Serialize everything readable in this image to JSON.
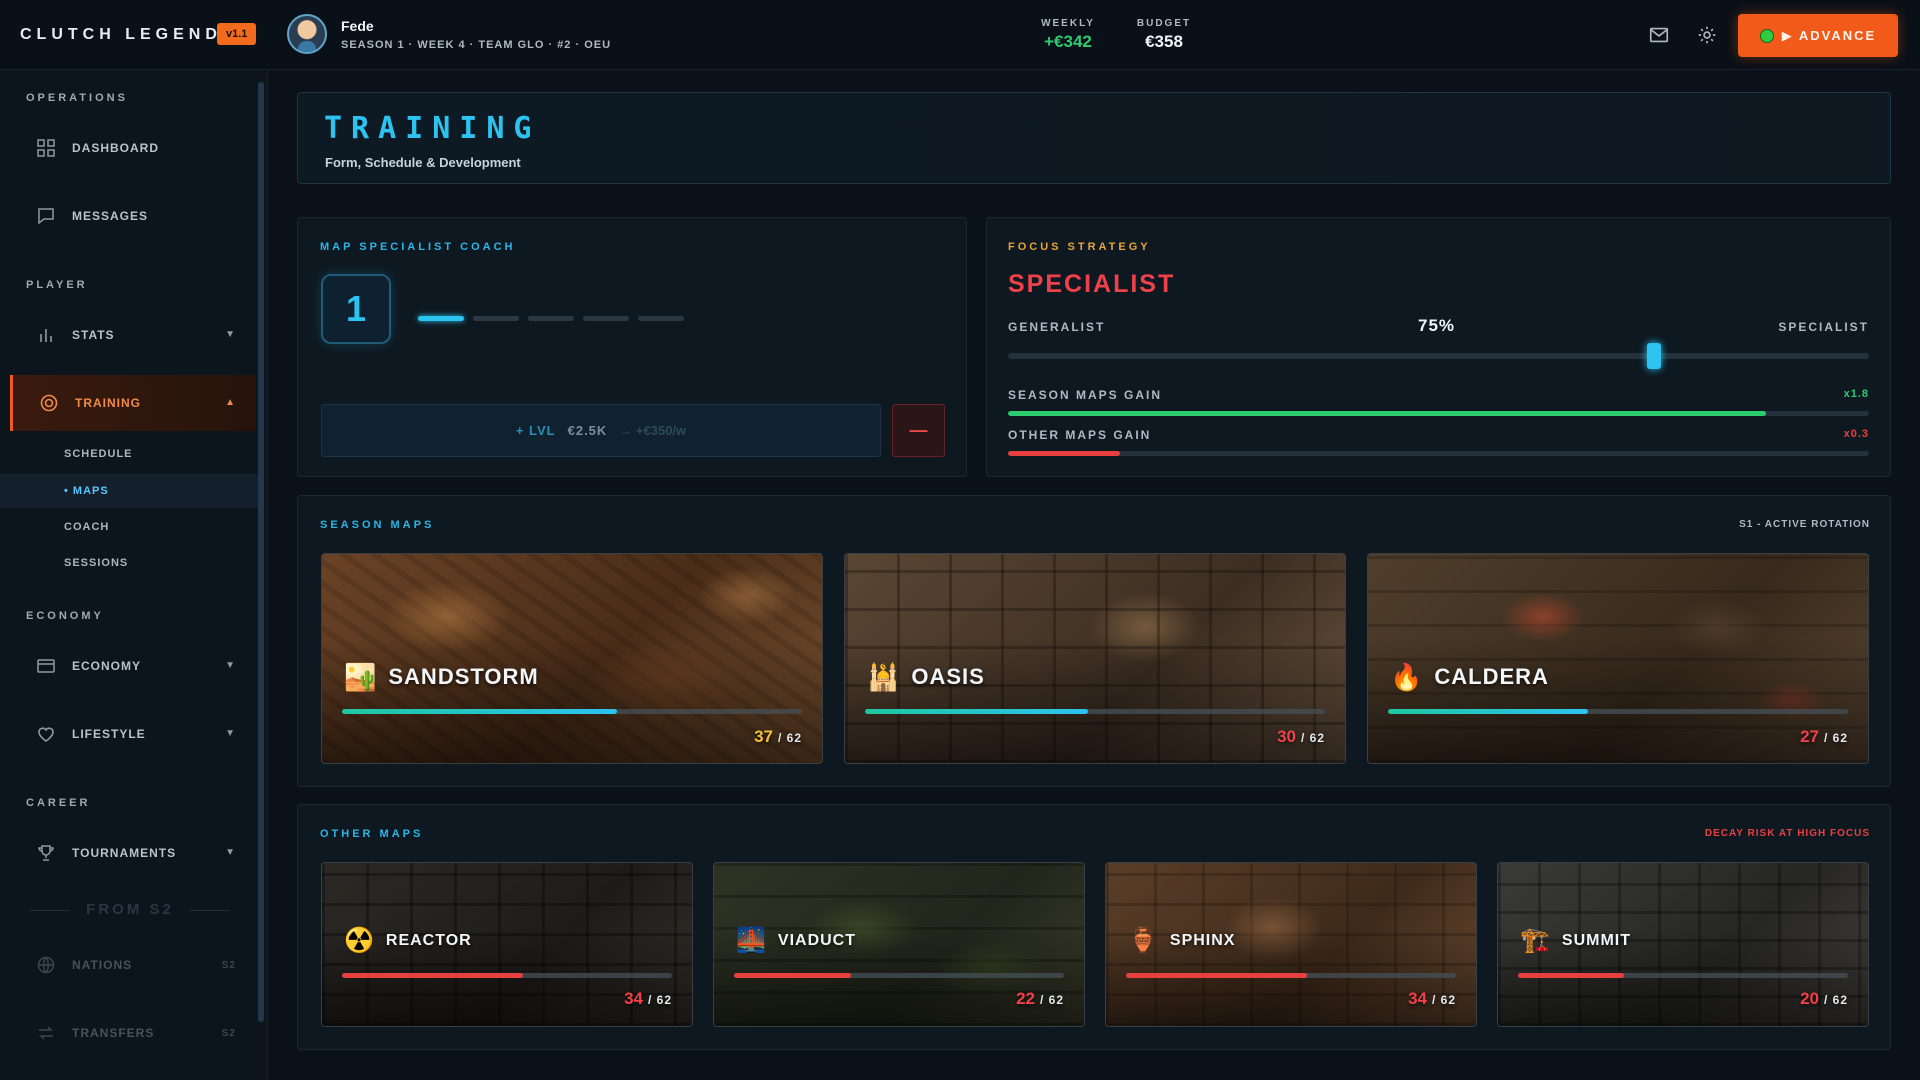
{
  "app": {
    "logo": "CLUTCH LEGEND",
    "version": "v1.1"
  },
  "player": {
    "name": "Fede",
    "meta": "SEASON 1 · WEEK 4 · TEAM GLO · #2 · OEU"
  },
  "stats": {
    "weekly_label": "WEEKLY",
    "weekly_value": "+€342",
    "budget_label": "BUDGET",
    "budget_value": "€358"
  },
  "header_actions": {
    "mail_icon": "mail-icon",
    "settings_icon": "gear-icon",
    "advance_label": "▶ ADVANCE"
  },
  "sidebar": {
    "sections": {
      "operations": "OPERATIONS",
      "player": "PLAYER",
      "economy": "ECONOMY",
      "career": "CAREER"
    },
    "items": {
      "dashboard": "DASHBOARD",
      "messages": "MESSAGES",
      "stats": "STATS",
      "training": "TRAINING",
      "economy": "ECONOMY",
      "lifestyle": "LIFESTYLE",
      "tournaments": "TOURNAMENTS",
      "nations": "NATIONS",
      "transfers": "TRANSFERS"
    },
    "training_sub": {
      "schedule": "SCHEDULE",
      "maps": "• MAPS",
      "coach": "COACH",
      "sessions": "SESSIONS"
    },
    "locked_divider": "FROM S2",
    "locked_tag": "S2"
  },
  "page": {
    "title": "TRAINING",
    "subtitle": "Form, Schedule & Development"
  },
  "coach": {
    "label": "MAP SPECIALIST COACH",
    "level": "1",
    "level_pips_filled": 1,
    "level_pips_total": 5,
    "upgrade_prefix": "+ LVL",
    "upgrade_cost": "€2.5K",
    "upgrade_weekly": "→ +€350/w",
    "downgrade_label": "—"
  },
  "focus": {
    "label": "FOCUS STRATEGY",
    "title": "SPECIALIST",
    "left_label": "GENERALIST",
    "right_label": "SPECIALIST",
    "percent_label": "75%",
    "percent": 0.75,
    "season_gain_label": "SEASON MAPS GAIN",
    "season_gain_mult": "x1.8",
    "season_gain_fill": 0.88,
    "other_gain_label": "OTHER MAPS GAIN",
    "other_gain_mult": "x0.3",
    "other_gain_fill": 0.13
  },
  "colors": {
    "accent_blue": "#2cc3f0",
    "accent_orange": "#f25a1a",
    "good_green": "#2ecc71",
    "bad_red": "#e8403f"
  },
  "season_maps": {
    "label": "SEASON MAPS",
    "note": "S1 - ACTIVE ROTATION",
    "total": "/ 62",
    "maps": [
      {
        "name": "SANDSTORM",
        "icon": "🏜️",
        "score": "37",
        "value": 37,
        "max": 62
      },
      {
        "name": "OASIS",
        "icon": "🕌",
        "score": "30",
        "value": 30,
        "max": 62
      },
      {
        "name": "CALDERA",
        "icon": "🔥",
        "score": "27",
        "value": 27,
        "max": 62
      }
    ]
  },
  "other_maps": {
    "label": "OTHER MAPS",
    "note": "DECAY RISK AT HIGH FOCUS",
    "total": "/ 62",
    "maps": [
      {
        "name": "REACTOR",
        "icon": "☢️",
        "score": "34",
        "value": 34,
        "max": 62
      },
      {
        "name": "VIADUCT",
        "icon": "🌉",
        "score": "22",
        "value": 22,
        "max": 62
      },
      {
        "name": "SPHINX",
        "icon": "🏺",
        "score": "34",
        "value": 34,
        "max": 62
      },
      {
        "name": "SUMMIT",
        "icon": "🏗️",
        "score": "20",
        "value": 20,
        "max": 62
      }
    ]
  }
}
